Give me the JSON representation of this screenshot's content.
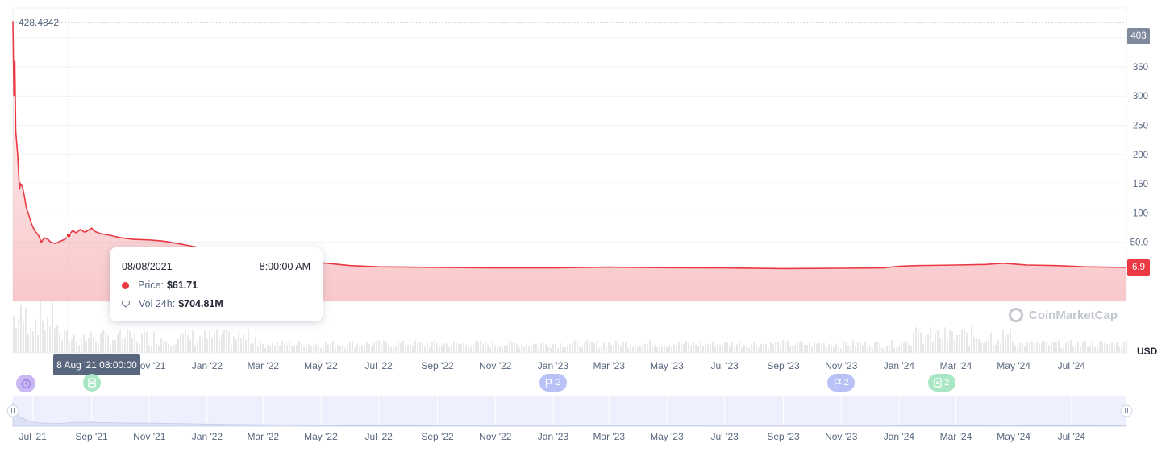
{
  "chart_data": {
    "type": "line",
    "currency_label": "USD",
    "y_ticks": [
      "350",
      "300",
      "250",
      "200",
      "150",
      "100",
      "50.0"
    ],
    "ylim": [
      0,
      440
    ],
    "max_label": "428.4842",
    "high_badge": "403",
    "current_badge": "6.9",
    "x_tick_labels": [
      "Jul '21",
      "Sep '21",
      "Nov '21",
      "Jan '22",
      "Mar '22",
      "May '22",
      "Jul '22",
      "Sep '22",
      "Nov '22",
      "Jan '23",
      "Mar '23",
      "May '23",
      "Jul '23",
      "Sep '23",
      "Nov '23",
      "Jan '24",
      "Mar '24",
      "May '24",
      "Jul '24"
    ],
    "main_x_labels_visible": [
      "Nov '21",
      "Jan '22",
      "Mar '22",
      "May '22",
      "Jul '22",
      "Sep '22",
      "Nov '22",
      "Jan '23",
      "Mar '23",
      "May '23",
      "Jul '23",
      "Sep '23",
      "Nov '23",
      "Jan '24",
      "Mar '24",
      "May '24",
      "Jul '24"
    ],
    "x_start": "2021-06-10",
    "x_end": "2024-08-28",
    "price_series": {
      "name": "Price",
      "color": "#ea3943",
      "points": [
        [
          "2021-06-10",
          428
        ],
        [
          "2021-06-11",
          300
        ],
        [
          "2021-06-12",
          360
        ],
        [
          "2021-06-13",
          240
        ],
        [
          "2021-06-15",
          200
        ],
        [
          "2021-06-17",
          140
        ],
        [
          "2021-06-18",
          150
        ],
        [
          "2021-06-20",
          145
        ],
        [
          "2021-06-22",
          130
        ],
        [
          "2021-06-24",
          110
        ],
        [
          "2021-06-27",
          95
        ],
        [
          "2021-06-30",
          80
        ],
        [
          "2021-07-03",
          70
        ],
        [
          "2021-07-07",
          62
        ],
        [
          "2021-07-10",
          50
        ],
        [
          "2021-07-13",
          58
        ],
        [
          "2021-07-17",
          55
        ],
        [
          "2021-07-20",
          50
        ],
        [
          "2021-07-25",
          48
        ],
        [
          "2021-07-30",
          52
        ],
        [
          "2021-08-04",
          55
        ],
        [
          "2021-08-08",
          61.71
        ],
        [
          "2021-08-12",
          70
        ],
        [
          "2021-08-16",
          66
        ],
        [
          "2021-08-20",
          72
        ],
        [
          "2021-08-25",
          67
        ],
        [
          "2021-09-01",
          74
        ],
        [
          "2021-09-05",
          68
        ],
        [
          "2021-09-10",
          65
        ],
        [
          "2021-09-20",
          62
        ],
        [
          "2021-10-01",
          58
        ],
        [
          "2021-10-15",
          55
        ],
        [
          "2021-11-01",
          54
        ],
        [
          "2021-11-15",
          52
        ],
        [
          "2021-12-01",
          48
        ],
        [
          "2021-12-20",
          42
        ],
        [
          "2022-01-10",
          35
        ],
        [
          "2022-02-01",
          30
        ],
        [
          "2022-03-01",
          25
        ],
        [
          "2022-04-01",
          20
        ],
        [
          "2022-05-01",
          15
        ],
        [
          "2022-06-01",
          10
        ],
        [
          "2022-07-01",
          8
        ],
        [
          "2022-09-01",
          7
        ],
        [
          "2022-11-01",
          6
        ],
        [
          "2023-01-01",
          6
        ],
        [
          "2023-03-01",
          7.5
        ],
        [
          "2023-05-01",
          6.5
        ],
        [
          "2023-07-01",
          6
        ],
        [
          "2023-09-01",
          5
        ],
        [
          "2023-11-01",
          5.5
        ],
        [
          "2023-12-15",
          6
        ],
        [
          "2024-01-01",
          9
        ],
        [
          "2024-01-20",
          10
        ],
        [
          "2024-03-01",
          11
        ],
        [
          "2024-04-01",
          12
        ],
        [
          "2024-04-20",
          14
        ],
        [
          "2024-05-15",
          11
        ],
        [
          "2024-06-15",
          10
        ],
        [
          "2024-07-15",
          8
        ],
        [
          "2024-08-28",
          6.9
        ]
      ]
    },
    "volume_series": {
      "name": "Vol 24h",
      "color": "#e6e8ea"
    },
    "tooltip": {
      "date": "08/08/2021",
      "time": "8:00:00 AM",
      "price_label": "Price:",
      "price_value": "$61.71",
      "volume_label": "Vol 24h:",
      "volume_value": "$704.81M"
    },
    "crosshair_label": "8 Aug '21 08:00:00",
    "events": [
      {
        "date": "2021-09-01",
        "kind": "news",
        "count": ""
      },
      {
        "date": "2023-01-01",
        "kind": "flag",
        "count": "2"
      },
      {
        "date": "2023-11-01",
        "kind": "flag",
        "count": "2"
      },
      {
        "date": "2024-02-15",
        "kind": "news",
        "count": "2"
      }
    ],
    "watermark": "CoinMarketCap"
  }
}
